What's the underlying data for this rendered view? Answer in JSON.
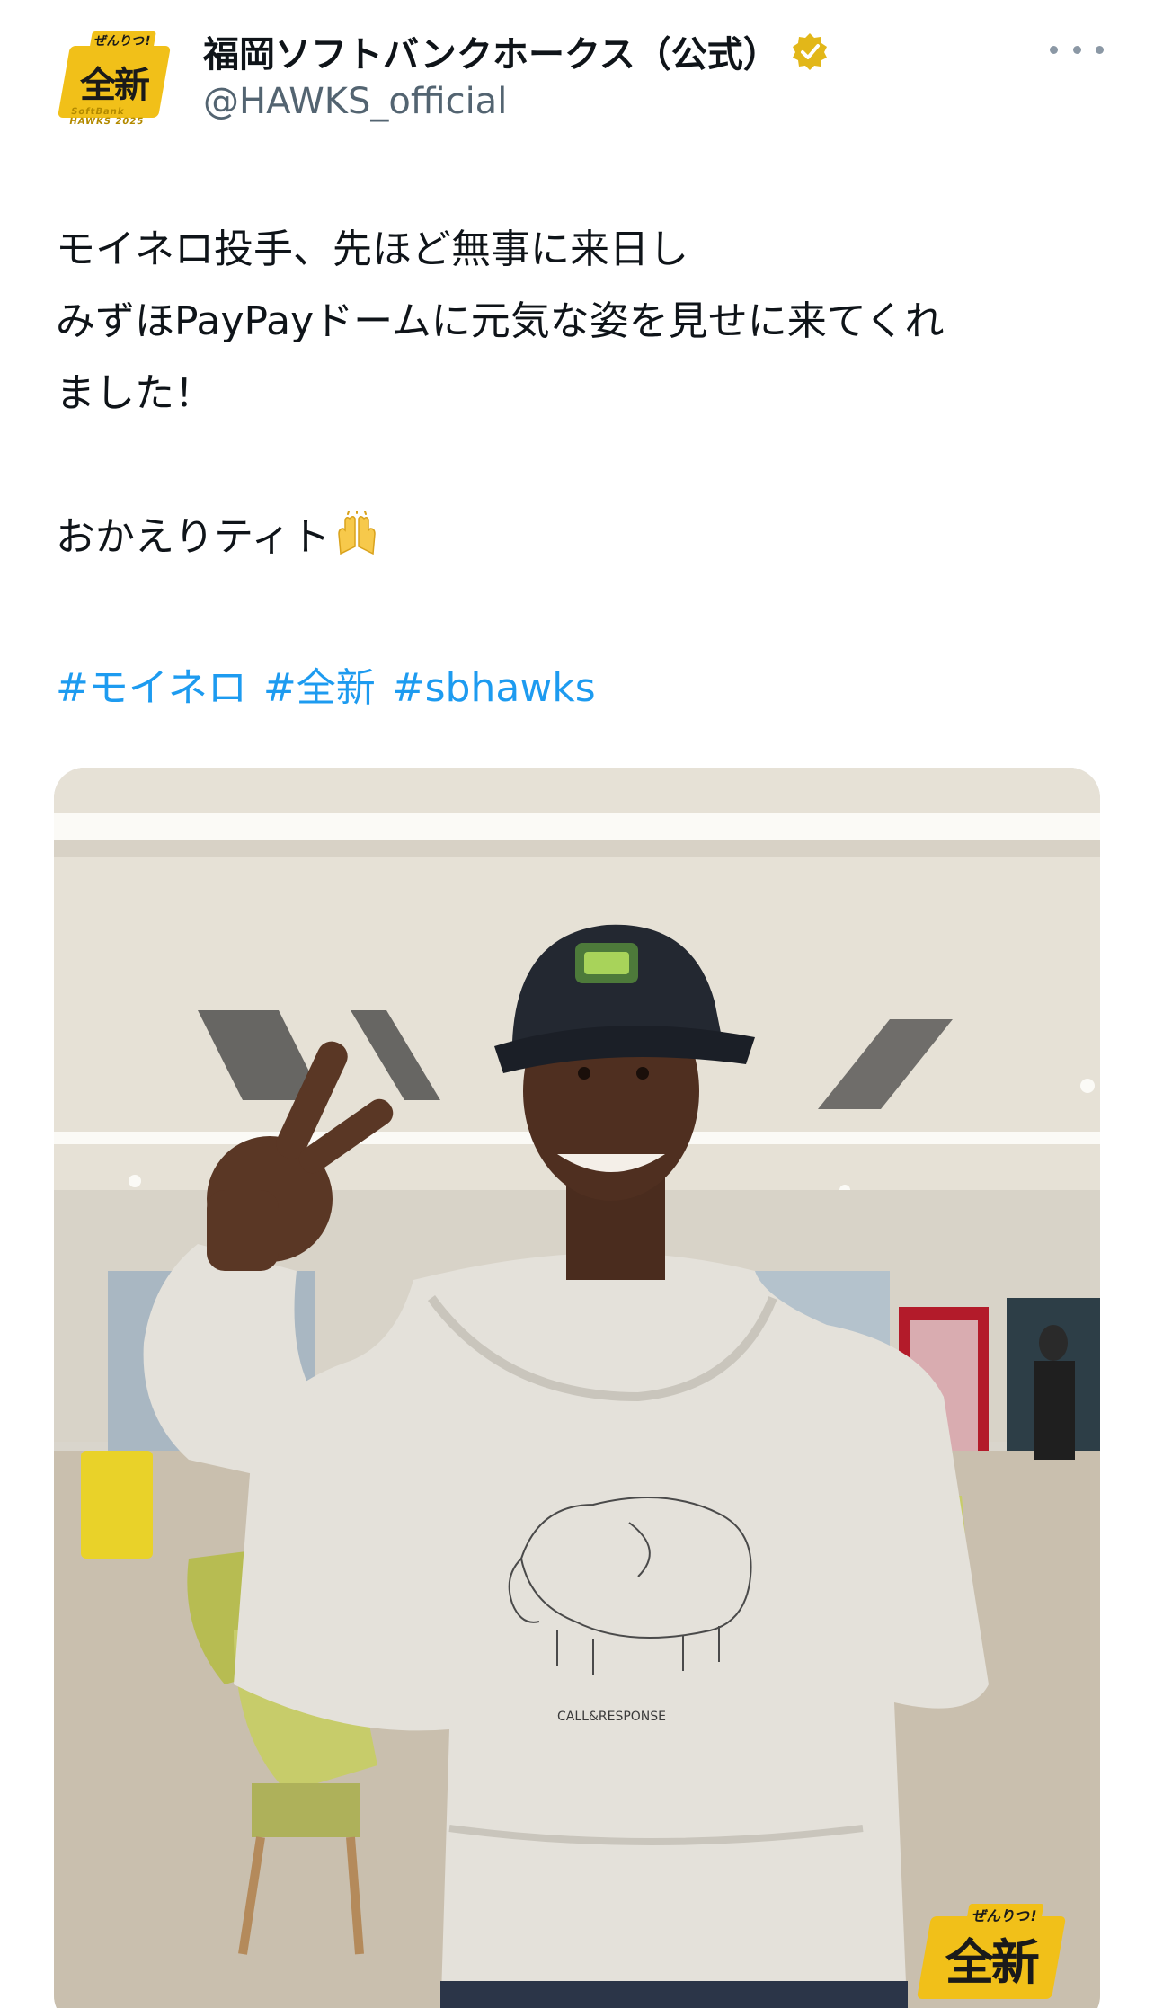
{
  "account": {
    "display_name": "福岡ソフトバンクホークス（公式）",
    "handle": "@HAWKS_official",
    "avatar_text": "全新",
    "avatar_top_text": "ぜんりつ!",
    "avatar_bottom_text": "SoftBank HAWKS 2025",
    "verified_badge_color": "#e2b719"
  },
  "post": {
    "lines": [
      "モイネロ投手、先ほど無事に来日し",
      "みずほPayPayドームに元気な姿を見せに来てくれ",
      "ました！"
    ],
    "greeting": "おかえりティト",
    "greeting_emoji": "raising-hands",
    "hashtags": [
      "#モイネロ",
      "#全新",
      "#sbhawks"
    ],
    "hashtag_color": "#1d9bf0"
  },
  "photo": {
    "sweatshirt_brand": "CALL&RESPONSE",
    "watermark_text": "全新",
    "watermark_top_text": "ぜんりつ!"
  },
  "icons": {
    "more": "more-horizontal-icon",
    "verified": "verified-badge-icon"
  }
}
